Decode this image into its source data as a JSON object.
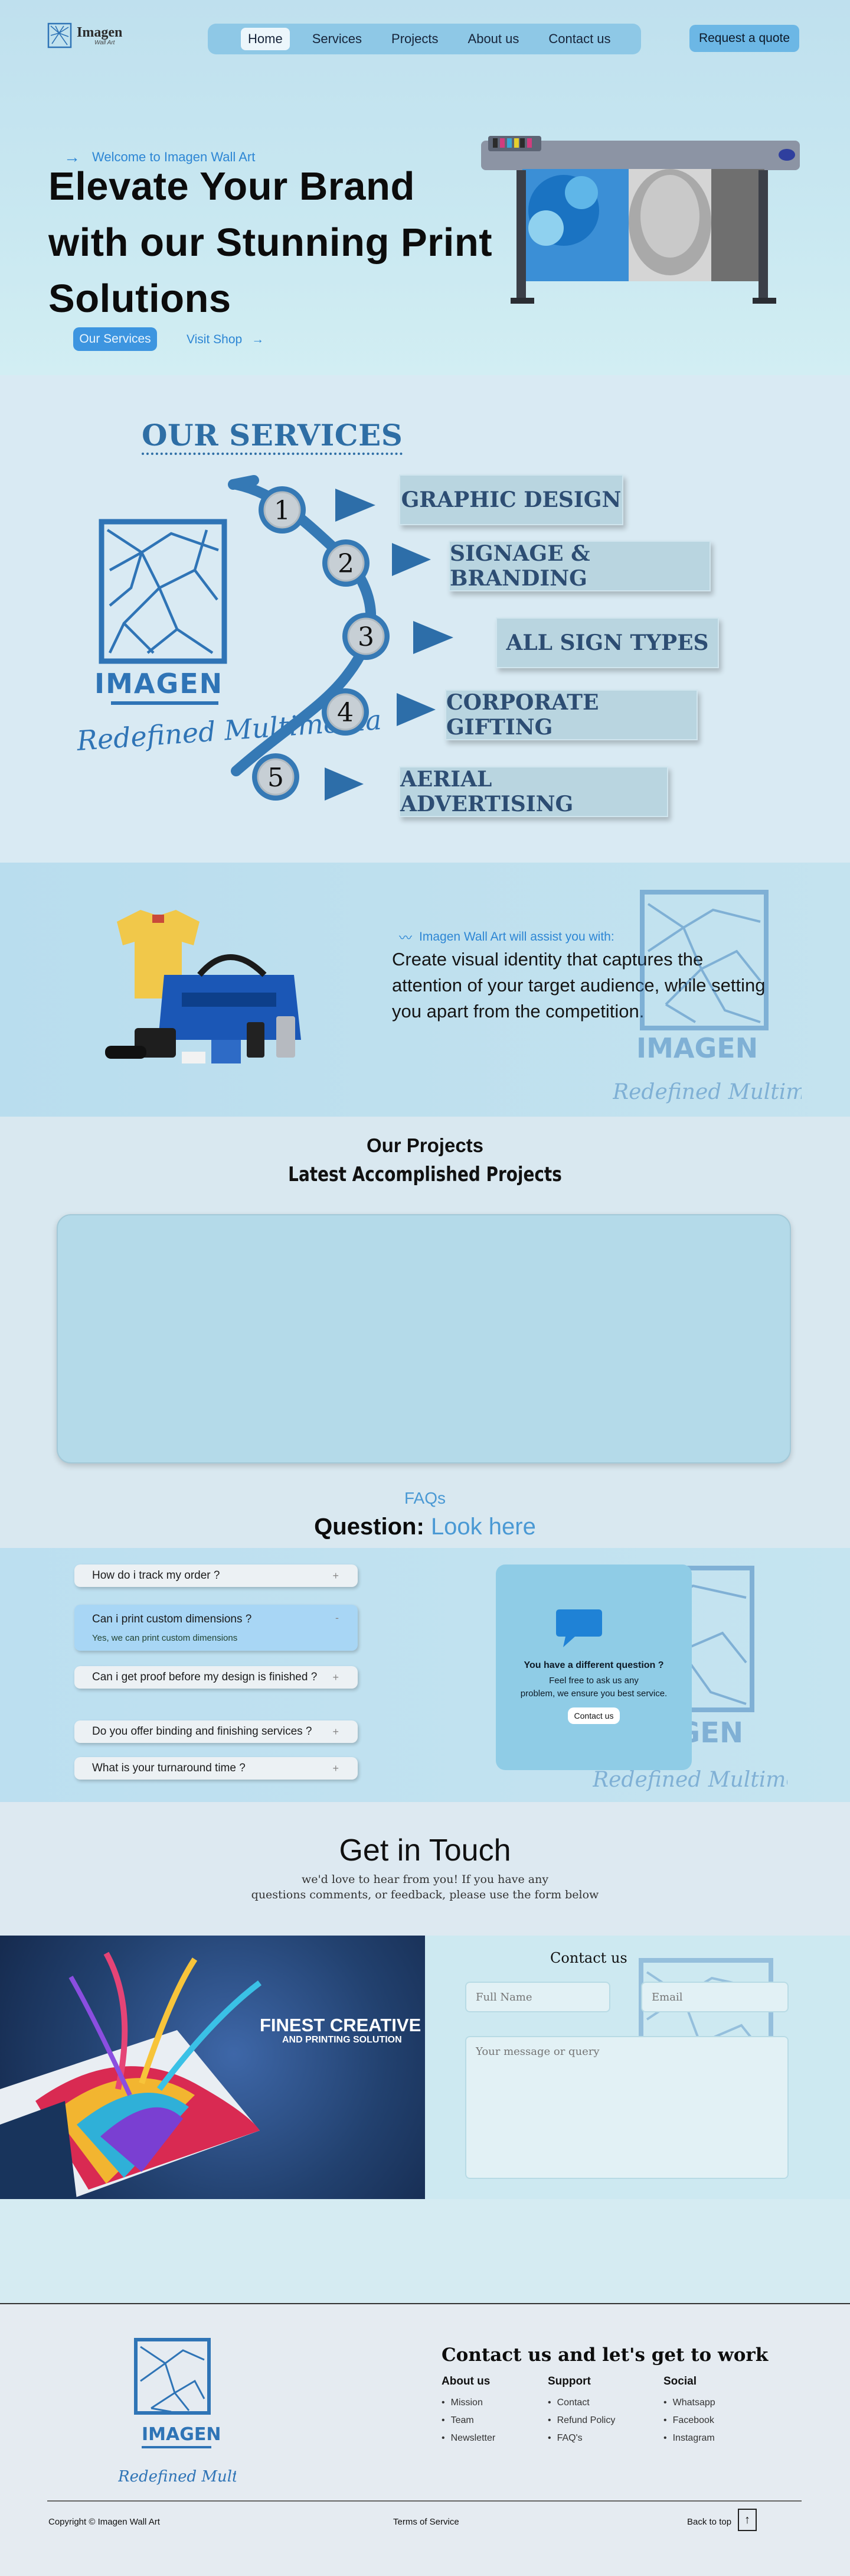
{
  "header": {
    "logo_name": "Imagen",
    "logo_tag": "Wall Art",
    "nav": [
      {
        "label": "Home",
        "active": true
      },
      {
        "label": "Services",
        "active": false
      },
      {
        "label": "Projects",
        "active": false
      },
      {
        "label": "About us",
        "active": false
      },
      {
        "label": "Contact us",
        "active": false
      }
    ],
    "quote_button": "Request a quote"
  },
  "hero": {
    "welcome": "Welcome to Imagen Wall Art",
    "title_line1": "Elevate Your Brand",
    "title_line2": "with our Stunning Print",
    "title_line3": "Solutions",
    "services_button": "Our Services",
    "shop_link": "Visit Shop",
    "image": "large-format-printer-photo"
  },
  "services": {
    "title": "OUR SERVICES",
    "brand_word": "IMAGEN",
    "brand_script": "Redefined Multimedia",
    "items": [
      {
        "number": "1",
        "label": "GRAPHIC DESIGN"
      },
      {
        "number": "2",
        "label": "SIGNAGE & BRANDING"
      },
      {
        "number": "3",
        "label": "ALL SIGN TYPES"
      },
      {
        "number": "4",
        "label": "CORPORATE GIFTING"
      },
      {
        "number": "5",
        "label": "AERIAL ADVERTISING"
      }
    ]
  },
  "identity": {
    "assist": "Imagen Wall Art will assist you with:",
    "line1": "Create visual  identity that captures  the",
    "line2": "attention of your  target audience, while  setting",
    "line3": "you apart from the competition.",
    "wm_brand": "IMAGEN",
    "wm_script": "Redefined Multimedia"
  },
  "projects": {
    "heading": "Our Projects",
    "subheading": "Latest Accomplished Projects"
  },
  "faq": {
    "tag": "FAQs",
    "heading_black": "Question:",
    "heading_blue": "Look here",
    "items": [
      {
        "q": "How do i track my order ?",
        "open": false
      },
      {
        "q": "Can i print custom dimensions ?",
        "open": true,
        "a": "Yes, we can print custom dimensions"
      },
      {
        "q": "Can i get proof before my design is finished ?",
        "open": false
      },
      {
        "q": "Do you offer binding and finishing services ?",
        "open": false
      },
      {
        "q": "What is your turnaround time ?",
        "open": false
      }
    ],
    "card": {
      "question": "You have a different question ?",
      "text1": "Feel free to ask us any",
      "text2": "problem, we ensure you best service.",
      "button": "Contact us"
    },
    "plus": "+",
    "minus": "-"
  },
  "touch": {
    "title": "Get in Touch",
    "line1": "we'd love to hear from you! If you have any",
    "line2": "questions comments, or feedback, please use the form below"
  },
  "contact_form": {
    "banner_line1": "FINEST CREATIVE",
    "banner_line2": "AND PRINTING SOLUTION",
    "title": "Contact us",
    "name_placeholder": "Full Name",
    "email_placeholder": "Email",
    "message_placeholder": "Your message or query"
  },
  "footer": {
    "brand": "IMAGEN",
    "brand_script": "Redefined Multimedia",
    "title": "Contact us and let's get to work",
    "columns": [
      {
        "heading": "About us",
        "links": [
          "Mission",
          "Team",
          "Newsletter"
        ]
      },
      {
        "heading": "Support",
        "links": [
          "Contact",
          "Refund Policy",
          "FAQ's"
        ]
      },
      {
        "heading": "Social",
        "links": [
          "Whatsapp",
          "Facebook",
          "Instagram"
        ]
      }
    ],
    "copyright": "Copyright © Imagen Wall Art",
    "terms": "Terms of Service",
    "back_to_top": "Back to top",
    "top_arrow": "↑"
  },
  "colors": {
    "accent": "#2d86d4",
    "nav_bg": "#8ec8e6",
    "button_blue": "#3d95e0",
    "services_blue": "#2f74b6",
    "faq_open": "#a8d6f5"
  }
}
